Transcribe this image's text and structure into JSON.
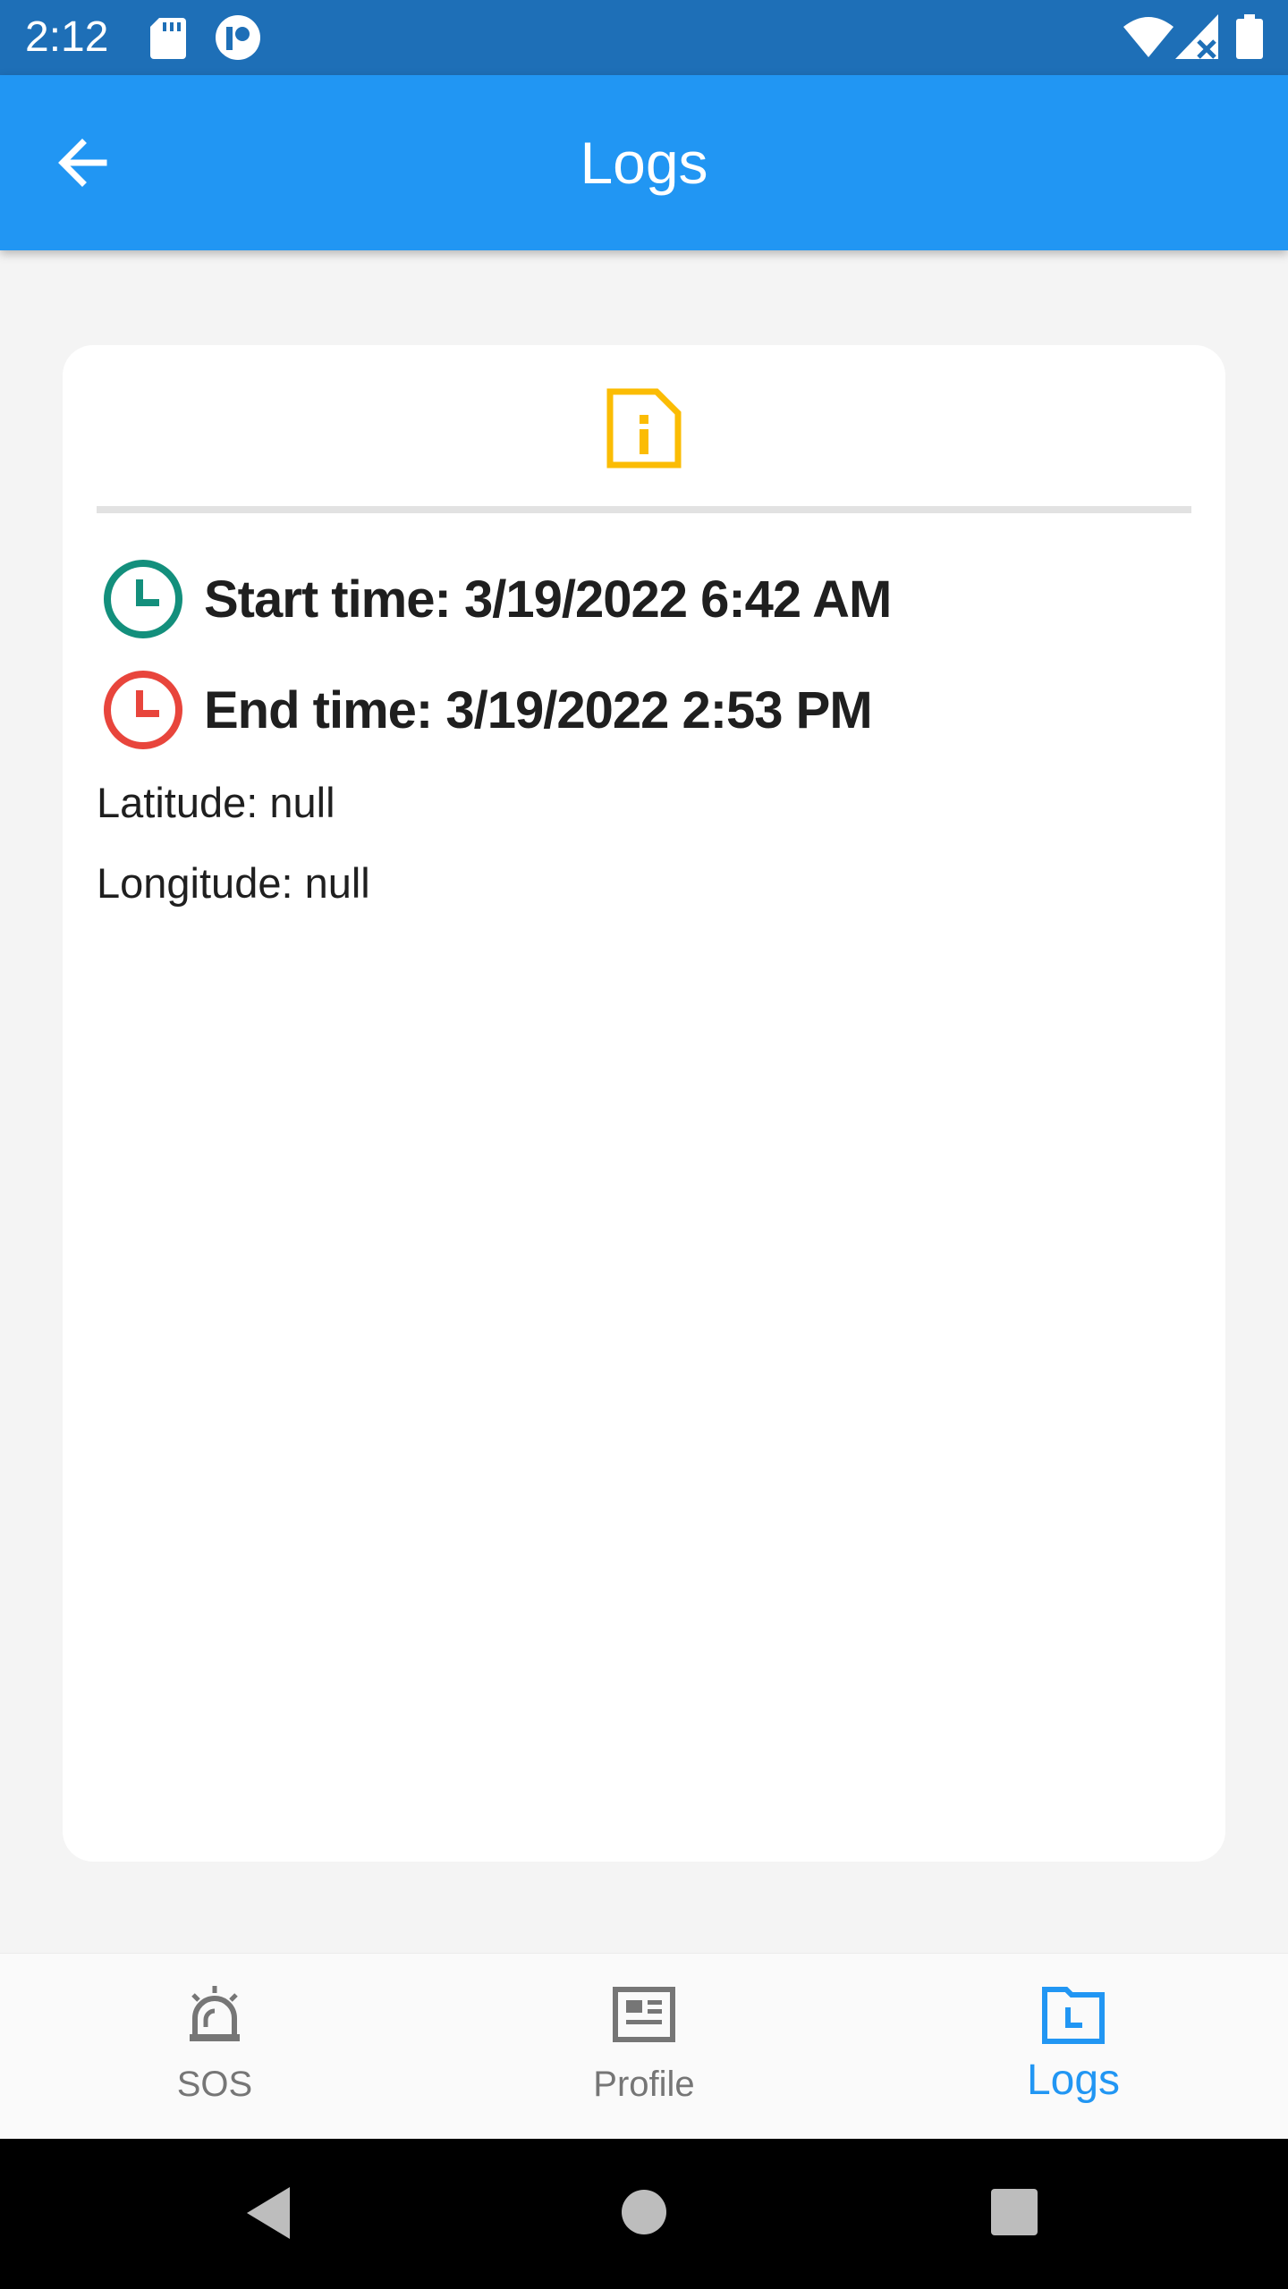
{
  "status_bar": {
    "time": "2:12",
    "left_icons": [
      "sd-card-icon",
      "notification-app-icon"
    ],
    "right_icons": [
      "wifi-icon",
      "signal-icon",
      "battery-icon"
    ]
  },
  "app_bar": {
    "title": "Logs",
    "back_icon": "arrow-back-icon",
    "color": "#2196f3"
  },
  "log_card": {
    "header_icon": "info-document-icon",
    "header_icon_color": "#fbbc04",
    "start": {
      "icon": "clock-icon",
      "color": "#138f7c",
      "text": "Start time: 3/19/2022 6:42 AM"
    },
    "end": {
      "icon": "clock-icon",
      "color": "#e8453c",
      "text": "End time: 3/19/2022 2:53 PM"
    },
    "latitude": "Latitude: null",
    "longitude": "Longitude: null"
  },
  "bottom_nav": {
    "items": [
      {
        "label": "SOS",
        "icon": "siren-icon",
        "active": false
      },
      {
        "label": "Profile",
        "icon": "profile-card-icon",
        "active": false
      },
      {
        "label": "Logs",
        "icon": "folder-clock-icon",
        "active": true
      }
    ],
    "active_color": "#2196f3",
    "inactive_color": "#767676"
  },
  "system_nav": [
    "back-triangle-icon",
    "home-circle-icon",
    "recents-square-icon"
  ]
}
